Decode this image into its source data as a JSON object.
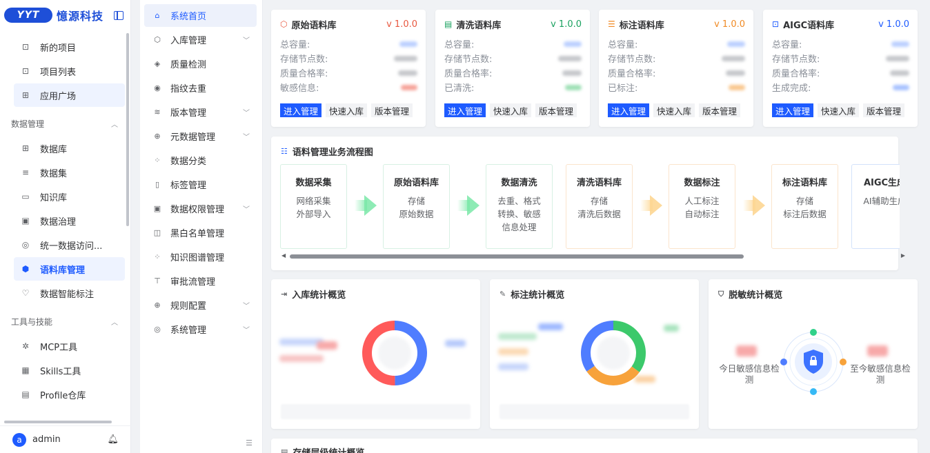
{
  "brand": {
    "logo_text": "YYT",
    "name": "憶源科技"
  },
  "sidebar": {
    "items_top": [
      {
        "label": "新的项目",
        "icon": "file-plus-icon",
        "glyph": "⊡"
      },
      {
        "label": "项目列表",
        "icon": "clipboard-icon",
        "glyph": "⊡"
      },
      {
        "label": "应用广场",
        "icon": "apps-icon",
        "glyph": "⊞"
      }
    ],
    "group_data": "数据管理",
    "items_data": [
      {
        "label": "数据库",
        "icon": "grid-icon",
        "glyph": "⊞"
      },
      {
        "label": "数据集",
        "icon": "database-icon",
        "glyph": "≡"
      },
      {
        "label": "知识库",
        "icon": "book-icon",
        "glyph": "▭"
      },
      {
        "label": "数据治理",
        "icon": "monitor-icon",
        "glyph": "▣"
      },
      {
        "label": "统一数据访问...",
        "icon": "compass-icon",
        "glyph": "◎"
      },
      {
        "label": "语料库管理",
        "icon": "gear-hex-icon",
        "glyph": "⬢"
      },
      {
        "label": "数据智能标注",
        "icon": "tag-bulb-icon",
        "glyph": "♡"
      }
    ],
    "group_tools": "工具与技能",
    "items_tools": [
      {
        "label": "MCP工具",
        "icon": "cog-icon",
        "glyph": "✲"
      },
      {
        "label": "Skills工具",
        "icon": "skills-icon",
        "glyph": "▦"
      },
      {
        "label": "Profile仓库",
        "icon": "profile-icon",
        "glyph": "▤"
      }
    ],
    "user": {
      "avatar_letter": "a",
      "name": "admin"
    }
  },
  "subnav": [
    {
      "label": "系统首页",
      "icon": "home-icon",
      "glyph": "⌂",
      "arrow": false
    },
    {
      "label": "入库管理",
      "icon": "box-icon",
      "glyph": "⬡",
      "arrow": true
    },
    {
      "label": "质量检测",
      "icon": "shield-icon",
      "glyph": "◈",
      "arrow": false
    },
    {
      "label": "指纹去重",
      "icon": "fingerprint-icon",
      "glyph": "◉",
      "arrow": false
    },
    {
      "label": "版本管理",
      "icon": "layers-icon",
      "glyph": "≋",
      "arrow": true
    },
    {
      "label": "元数据管理",
      "icon": "globe-icon",
      "glyph": "⊕",
      "arrow": true
    },
    {
      "label": "数据分类",
      "icon": "category-icon",
      "glyph": "⁘",
      "arrow": false
    },
    {
      "label": "标签管理",
      "icon": "bookmark-icon",
      "glyph": "▯",
      "arrow": false
    },
    {
      "label": "数据权限管理",
      "icon": "permission-icon",
      "glyph": "▣",
      "arrow": true
    },
    {
      "label": "黑白名单管理",
      "icon": "list-icon",
      "glyph": "◫",
      "arrow": false
    },
    {
      "label": "知识图谱管理",
      "icon": "graph-icon",
      "glyph": "⁘",
      "arrow": false
    },
    {
      "label": "审批流管理",
      "icon": "flow-icon",
      "glyph": "⊤",
      "arrow": false
    },
    {
      "label": "规则配置",
      "icon": "rule-icon",
      "glyph": "⊕",
      "arrow": true
    },
    {
      "label": "系统管理",
      "icon": "settings-icon",
      "glyph": "◎",
      "arrow": true
    }
  ],
  "libraries": [
    {
      "title": "原始语料库",
      "icon": "cube-icon",
      "glyph": "⬡",
      "version": "v 1.0.0",
      "color": "#e8573f",
      "ver_color": "#e8573f",
      "rows": [
        "总容量:",
        "存储节点数:",
        "质量合格率:",
        "敏感信息:"
      ],
      "dot_color": "#f27a6b",
      "buttons": [
        "进入管理",
        "快速入库",
        "版本管理"
      ]
    },
    {
      "title": "清洗语料库",
      "icon": "doc-icon",
      "glyph": "▤",
      "version": "v 1.0.0",
      "color": "#19a15f",
      "ver_color": "#19a15f",
      "rows": [
        "总容量:",
        "存储节点数:",
        "质量合格率:",
        "已清洗:"
      ],
      "dot_color": "#6bd08f",
      "buttons": [
        "进入管理",
        "快速入库",
        "版本管理"
      ]
    },
    {
      "title": "标注语料库",
      "icon": "table-icon",
      "glyph": "☰",
      "version": "v 1.0.0",
      "color": "#f08a24",
      "ver_color": "#f08a24",
      "rows": [
        "总容量:",
        "存储节点数:",
        "质量合格率:",
        "已标注:"
      ],
      "dot_color": "#f6b26b",
      "buttons": [
        "进入管理",
        "快速入库",
        "版本管理"
      ]
    },
    {
      "title": "AIGC语料库",
      "icon": "robot-icon",
      "glyph": "⊡",
      "version": "v 1.0.0",
      "color": "#1e5bff",
      "ver_color": "#1e5bff",
      "rows": [
        "总容量:",
        "存储节点数:",
        "质量合格率:",
        "生成完成:"
      ],
      "dot_color": "#7aa2ff",
      "buttons": [
        "进入管理",
        "快速入库",
        "版本管理"
      ]
    }
  ],
  "flow": {
    "title": "语料管理业务流程图",
    "steps": [
      {
        "name": "数据采集",
        "lines": [
          "网络采集",
          "外部导入"
        ],
        "tone": "green"
      },
      {
        "name": "原始语料库",
        "lines": [
          "存储",
          "原始数据"
        ],
        "tone": "green"
      },
      {
        "name": "数据清洗",
        "lines": [
          "去重、格式",
          "转换、敏感",
          "信息处理"
        ],
        "tone": "green"
      },
      {
        "name": "清洗语料库",
        "lines": [
          "存储",
          "清洗后数据"
        ],
        "tone": "orange"
      },
      {
        "name": "数据标注",
        "lines": [
          "人工标注",
          "自动标注"
        ],
        "tone": "orange"
      },
      {
        "name": "标注语料库",
        "lines": [
          "存储",
          "标注后数据"
        ],
        "tone": "orange"
      },
      {
        "name": "AIGC生成",
        "lines": [
          "AI辅助生成"
        ],
        "tone": "blue"
      }
    ]
  },
  "stats": {
    "ingest_title": "入库统计概览",
    "annotate_title": "标注统计概览",
    "desens_title": "脱敏统计概览",
    "desens_today": "今日敏感信息检测",
    "desens_total": "至今敏感信息检测"
  },
  "storage_title": "存储层级统计概览",
  "colors": {
    "primary": "#1e5bff",
    "green": "#19a15f",
    "orange": "#f08a24",
    "red": "#e8573f"
  }
}
